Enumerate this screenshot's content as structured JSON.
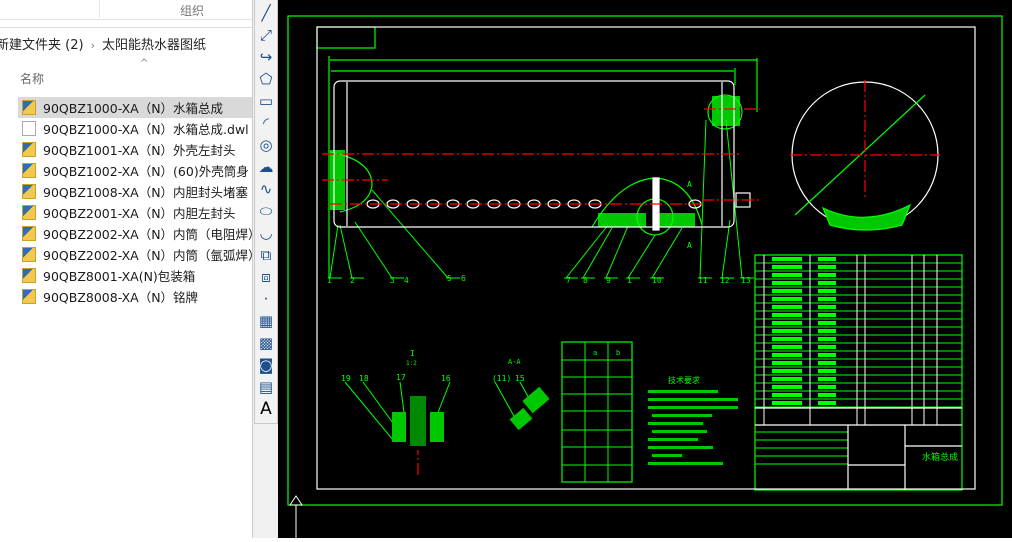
{
  "explorer": {
    "ribbon_group": "组织",
    "breadcrumb": [
      "新建文件夹 (2)",
      "太阳能热水器图纸"
    ],
    "column_header": "名称",
    "files": [
      {
        "name": "90QBZ1000-XA（N）水箱总成",
        "type": "dwg",
        "selected": true
      },
      {
        "name": "90QBZ1000-XA（N）水箱总成.dwl",
        "type": "doc",
        "selected": false
      },
      {
        "name": "90QBZ1001-XA（N）外壳左封头",
        "type": "dwg",
        "selected": false
      },
      {
        "name": "90QBZ1002-XA（N）(60)外壳筒身",
        "type": "dwg",
        "selected": false
      },
      {
        "name": "90QBZ1008-XA（N）内胆封头堵塞",
        "type": "dwg",
        "selected": false
      },
      {
        "name": "90QBZ2001-XA（N）内胆左封头",
        "type": "dwg",
        "selected": false
      },
      {
        "name": "90QBZ2002-XA（N）内筒（电阻焊）",
        "type": "dwg",
        "selected": false
      },
      {
        "name": "90QBZ2002-XA（N）内筒（氩弧焊）",
        "type": "dwg",
        "selected": false
      },
      {
        "name": "90QBZ8001-XA(N)包装箱",
        "type": "dwg",
        "selected": false
      },
      {
        "name": "90QBZ8008-XA（N）铭牌",
        "type": "dwg",
        "selected": false
      }
    ]
  },
  "toolbar": [
    "line-icon",
    "construction-line-icon",
    "polyline-icon",
    "polygon-icon",
    "rectangle-icon",
    "arc-icon",
    "circle-icon",
    "revision-cloud-icon",
    "spline-icon",
    "ellipse-icon",
    "ellipse-arc-icon",
    "insert-block-icon",
    "make-block-icon",
    "point-icon",
    "hatch-icon",
    "gradient-icon",
    "region-icon",
    "table-icon",
    "multiline-text-icon"
  ],
  "drawing": {
    "part_labels": [
      "1",
      "2",
      "3",
      "4",
      "5",
      "6",
      "7",
      "8",
      "9",
      "1",
      "10",
      "11",
      "12",
      "13"
    ],
    "section_label": "A",
    "detail_label": "I",
    "detail_scale": "1:2",
    "section_view_label": "A-A",
    "detail_parts": [
      "19",
      "18",
      "17",
      "16"
    ],
    "section_parts": [
      "(11)",
      "15"
    ],
    "small_table_headers": [
      "a",
      "b"
    ],
    "tech_title": "技术要求",
    "title_block_name": "水箱总成",
    "colors": {
      "frame": "#00ff00",
      "inner": "#ffffff",
      "center": "#ff0000",
      "background": "#000000"
    }
  }
}
